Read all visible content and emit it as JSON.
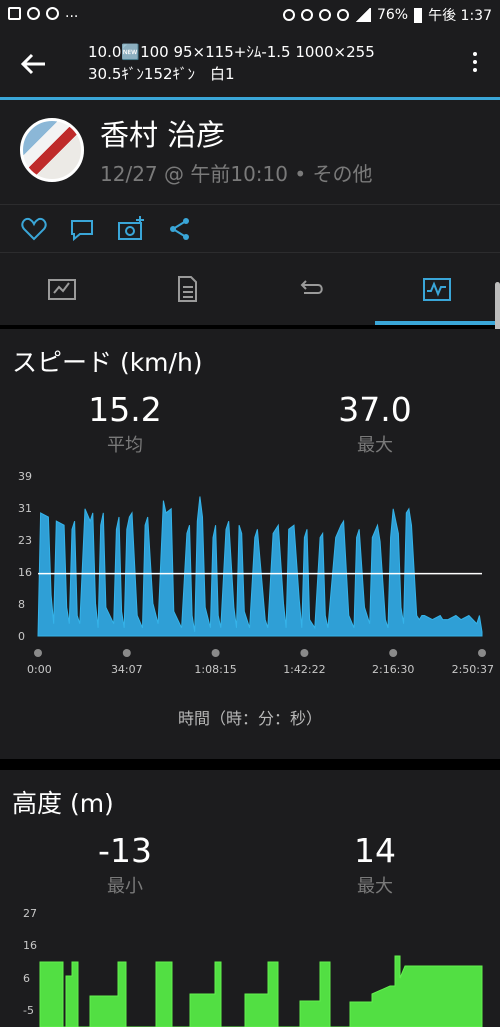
{
  "status": {
    "battery": "76%",
    "time": "午後 1:37",
    "ellipsis": "..."
  },
  "appbar": {
    "title": "10.0🆕100 95×115+ｼﾑ-1.5  1000×255\n30.5ｷﾞﾝ152ｷﾞﾝ　白1"
  },
  "profile": {
    "name": "香村 治彦",
    "meta": "12/27 @ 午前10:10 • その他"
  },
  "speed": {
    "title": "スピード (km/h)",
    "avg_value": "15.2",
    "avg_label": "平均",
    "max_value": "37.0",
    "max_label": "最大",
    "x_caption": "時間（時：分：秒）"
  },
  "altitude": {
    "title": "高度 (m)",
    "min_value": "-13",
    "min_label": "最小",
    "max_value": "14",
    "max_label": "最大"
  },
  "chart_data": [
    {
      "type": "area",
      "title": "スピード (km/h)",
      "xlabel": "時間（時：分：秒）",
      "ylabel": "km/h",
      "ylim": [
        0,
        39
      ],
      "yticks": [
        "39",
        "31",
        "23",
        "16",
        "8",
        "0"
      ],
      "xticks": [
        "0:00",
        "34:07",
        "1:08:15",
        "1:42:22",
        "2:16:30",
        "2:50:37"
      ],
      "average": 15.2,
      "maximum": 37.0,
      "x_minutes": [
        0,
        1,
        4,
        5,
        6,
        7,
        10,
        11,
        12,
        13,
        14,
        15,
        16,
        18,
        20,
        21,
        22,
        23,
        24,
        25,
        26,
        29,
        30,
        31,
        32,
        33,
        34,
        35,
        36,
        38,
        40,
        41,
        42,
        44,
        46,
        48,
        49,
        51,
        52,
        55,
        57,
        58,
        59,
        60,
        61,
        62,
        63,
        64,
        66,
        67,
        68,
        69,
        70,
        72,
        73,
        75,
        76,
        77,
        78,
        79,
        81,
        83,
        84,
        87,
        88,
        90,
        92,
        94,
        95,
        96,
        98,
        100,
        101,
        102,
        103,
        104,
        106,
        108,
        109,
        110,
        111,
        114,
        116,
        117,
        119,
        121,
        122,
        123,
        125,
        127,
        128,
        130,
        131,
        133,
        134,
        135,
        136,
        138,
        139,
        140,
        141,
        142,
        143,
        145,
        146,
        147,
        148,
        151,
        154,
        155,
        157,
        160,
        162,
        165,
        168,
        169,
        170
      ],
      "y_values": [
        0,
        30,
        29,
        10,
        3,
        28,
        27,
        7,
        3,
        26,
        28,
        5,
        3,
        31,
        28,
        30,
        8,
        2,
        27,
        30,
        7,
        3,
        26,
        29,
        6,
        2,
        26,
        29,
        30,
        5,
        2,
        27,
        29,
        8,
        3,
        33,
        30,
        31,
        6,
        2,
        25,
        27,
        5,
        1,
        28,
        34,
        29,
        7,
        2,
        24,
        27,
        5,
        2,
        26,
        28,
        7,
        2,
        27,
        25,
        6,
        2,
        24,
        26,
        4,
        2,
        25,
        27,
        8,
        2,
        26,
        27,
        9,
        2,
        24,
        26,
        4,
        2,
        24,
        25,
        5,
        2,
        24,
        27,
        28,
        5,
        2,
        24,
        26,
        7,
        3,
        24,
        27,
        23,
        4,
        2,
        24,
        31,
        25,
        7,
        3,
        30,
        31,
        27,
        5,
        4,
        5,
        5,
        4,
        5,
        4,
        4,
        5,
        4,
        5,
        3,
        5,
        1
      ]
    },
    {
      "type": "area",
      "title": "高度 (m)",
      "ylabel": "m",
      "yticks": [
        "27",
        "16",
        "6",
        "-5"
      ],
      "minimum": -13,
      "maximum": 14
    }
  ]
}
